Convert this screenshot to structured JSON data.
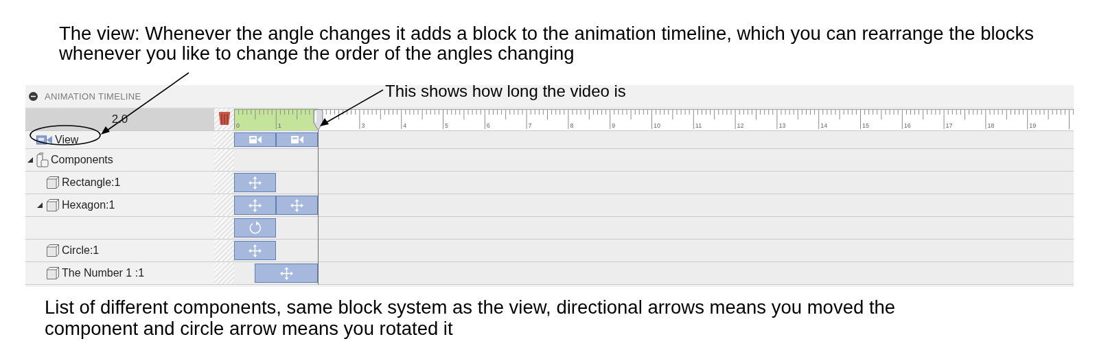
{
  "annotations": {
    "top": "The view: Whenever the angle changes it adds a block to the animation timeline, which you can rearrange the blocks whenever you like to change the order of the angles changing",
    "playhead_note": "This shows how long the video is",
    "bottom": "List of different components, same block system as the view, directional arrows means you moved the component and circle arrow means you rotated it"
  },
  "panel": {
    "title": "ANIMATION TIMELINE",
    "current_time": "2.0",
    "ruler": [
      {
        "label": "0",
        "covered": false
      },
      {
        "label": "1",
        "covered": false
      },
      {
        "covered": true
      },
      {
        "label": "3",
        "covered": false
      },
      {
        "label": "4",
        "covered": false
      },
      {
        "label": "5",
        "covered": false
      },
      {
        "label": "6",
        "covered": false
      },
      {
        "label": "7",
        "covered": false
      },
      {
        "label": "8",
        "covered": false
      },
      {
        "label": "9",
        "covered": false
      },
      {
        "label": "10",
        "covered": false
      },
      {
        "label": "11",
        "covered": false
      },
      {
        "label": "12",
        "covered": false
      },
      {
        "label": "13",
        "covered": false
      },
      {
        "label": "14",
        "covered": false
      },
      {
        "label": "15",
        "covered": false
      },
      {
        "label": "16",
        "covered": false
      },
      {
        "label": "17",
        "covered": false
      },
      {
        "label": "18",
        "covered": false
      },
      {
        "label": "19",
        "covered": false
      }
    ],
    "rows": [
      {
        "label": "View",
        "kind": "view",
        "tracks": [
          [
            {
              "kind": "camera",
              "delayed": false
            },
            {
              "kind": "camera",
              "delayed": false
            }
          ]
        ]
      },
      {
        "label": "Components",
        "kind": "group",
        "expanded": true,
        "children": [
          {
            "label": "Rectangle:1",
            "kind": "component",
            "tracks": [
              [
                {
                  "kind": "move",
                  "delayed": false
                }
              ]
            ]
          },
          {
            "label": "Hexagon:1",
            "kind": "component",
            "expanded": true,
            "tracks": [
              [
                {
                  "kind": "move",
                  "delayed": false
                },
                {
                  "kind": "move",
                  "delayed": false
                }
              ],
              [
                {
                  "kind": "rotate",
                  "delayed": false
                }
              ]
            ]
          },
          {
            "label": "Circle:1",
            "kind": "component",
            "tracks": [
              [
                {
                  "kind": "move",
                  "delayed": false
                }
              ]
            ]
          },
          {
            "label": "The Number 1 :1",
            "kind": "component",
            "tracks": [
              [
                {
                  "kind": "move",
                  "delayed": true
                }
              ]
            ]
          }
        ]
      }
    ]
  }
}
